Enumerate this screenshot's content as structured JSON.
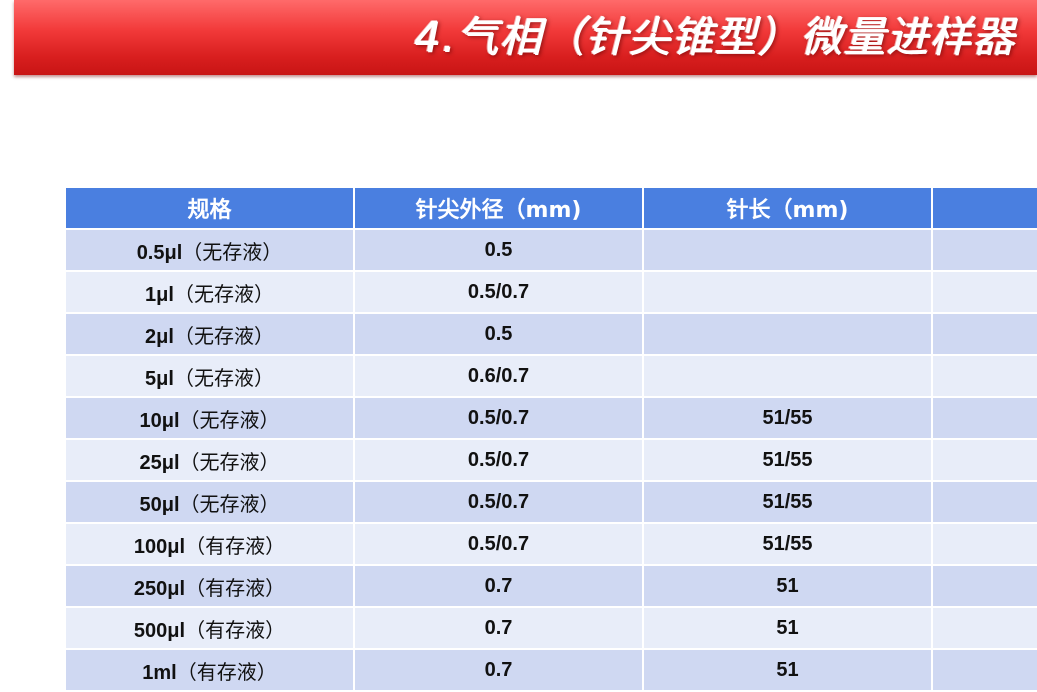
{
  "slide": {
    "title": "4.气相（针尖锥型）微量进样器",
    "colors": {
      "title_bar": "#e02a2a",
      "header": "#4a7fe0",
      "row_odd": "#cfd8f2",
      "row_even": "#e8edf9"
    }
  },
  "table": {
    "headers": [
      "规格",
      "针尖外径（mm)",
      "针长（mm)",
      ""
    ],
    "rows": [
      {
        "capacity": "0.5μl",
        "note": "（无存液）",
        "tip_od": "0.5",
        "needle_len": "",
        "extra": ""
      },
      {
        "capacity": "1μl",
        "note": "（无存液）",
        "tip_od": "0.5/0.7",
        "needle_len": "",
        "extra": ""
      },
      {
        "capacity": "2μl",
        "note": "（无存液）",
        "tip_od": "0.5",
        "needle_len": "",
        "extra": ""
      },
      {
        "capacity": "5μl",
        "note": "（无存液）",
        "tip_od": "0.6/0.7",
        "needle_len": "",
        "extra": ""
      },
      {
        "capacity": "10μl",
        "note": "（无存液）",
        "tip_od": "0.5/0.7",
        "needle_len": "51/55",
        "extra": ""
      },
      {
        "capacity": "25μl",
        "note": "（无存液）",
        "tip_od": "0.5/0.7",
        "needle_len": "51/55",
        "extra": ""
      },
      {
        "capacity": "50μl",
        "note": "（无存液）",
        "tip_od": "0.5/0.7",
        "needle_len": "51/55",
        "extra": ""
      },
      {
        "capacity": "100μl",
        "note": "（有存液）",
        "tip_od": "0.5/0.7",
        "needle_len": "51/55",
        "extra": ""
      },
      {
        "capacity": "250μl",
        "note": "（有存液）",
        "tip_od": "0.7",
        "needle_len": "51",
        "extra": ""
      },
      {
        "capacity": "500μl",
        "note": "（有存液）",
        "tip_od": "0.7",
        "needle_len": "51",
        "extra": ""
      },
      {
        "capacity": "1ml",
        "note": "（有存液）",
        "tip_od": "0.7",
        "needle_len": "51",
        "extra": ""
      }
    ]
  }
}
